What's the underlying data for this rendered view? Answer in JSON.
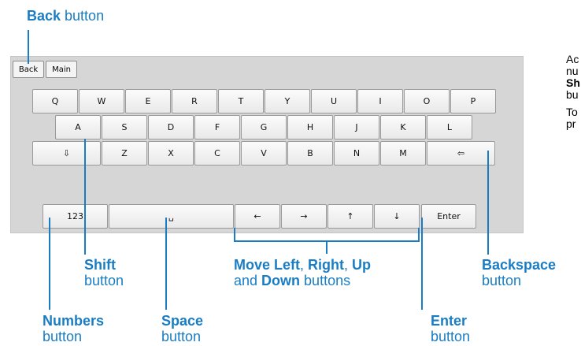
{
  "topbar": {
    "back_label": "Back",
    "main_label": "Main"
  },
  "keyboard": {
    "row1": [
      "Q",
      "W",
      "E",
      "R",
      "T",
      "Y",
      "U",
      "I",
      "O",
      "P"
    ],
    "row2": [
      "A",
      "S",
      "D",
      "F",
      "G",
      "H",
      "J",
      "K",
      "L"
    ],
    "row3": [
      "⇩",
      "Z",
      "X",
      "C",
      "V",
      "B",
      "N",
      "M",
      "⇦"
    ],
    "row4": [
      "123",
      "␣",
      "←",
      "→",
      "↑",
      "↓",
      "Enter"
    ]
  },
  "callouts": {
    "back": {
      "bold": "Back",
      "rest": " button"
    },
    "shift": {
      "bold": "Shift",
      "rest": "button"
    },
    "numbers": {
      "bold": "Numbers",
      "rest": "button"
    },
    "space": {
      "bold": "Space",
      "rest": "button"
    },
    "move": {
      "b1": "Move Left",
      "t1": ", ",
      "b2": "Right",
      "t2": ", ",
      "b3": "Up",
      "t3": "and ",
      "b4": "Down",
      "t4": " buttons"
    },
    "enter": {
      "bold": "Enter",
      "rest": "button"
    },
    "backspace": {
      "bold": "Backspace",
      "rest": "button"
    }
  },
  "side_text": {
    "p1_line1": "Ac",
    "p1_line2": "nu",
    "p1_line3": "Sh",
    "p1_line4": "bu",
    "p2_line1": "To",
    "p2_line2": "pr"
  },
  "colors": {
    "callout": "#1a7dc4",
    "panel": "#d6d6d6"
  }
}
